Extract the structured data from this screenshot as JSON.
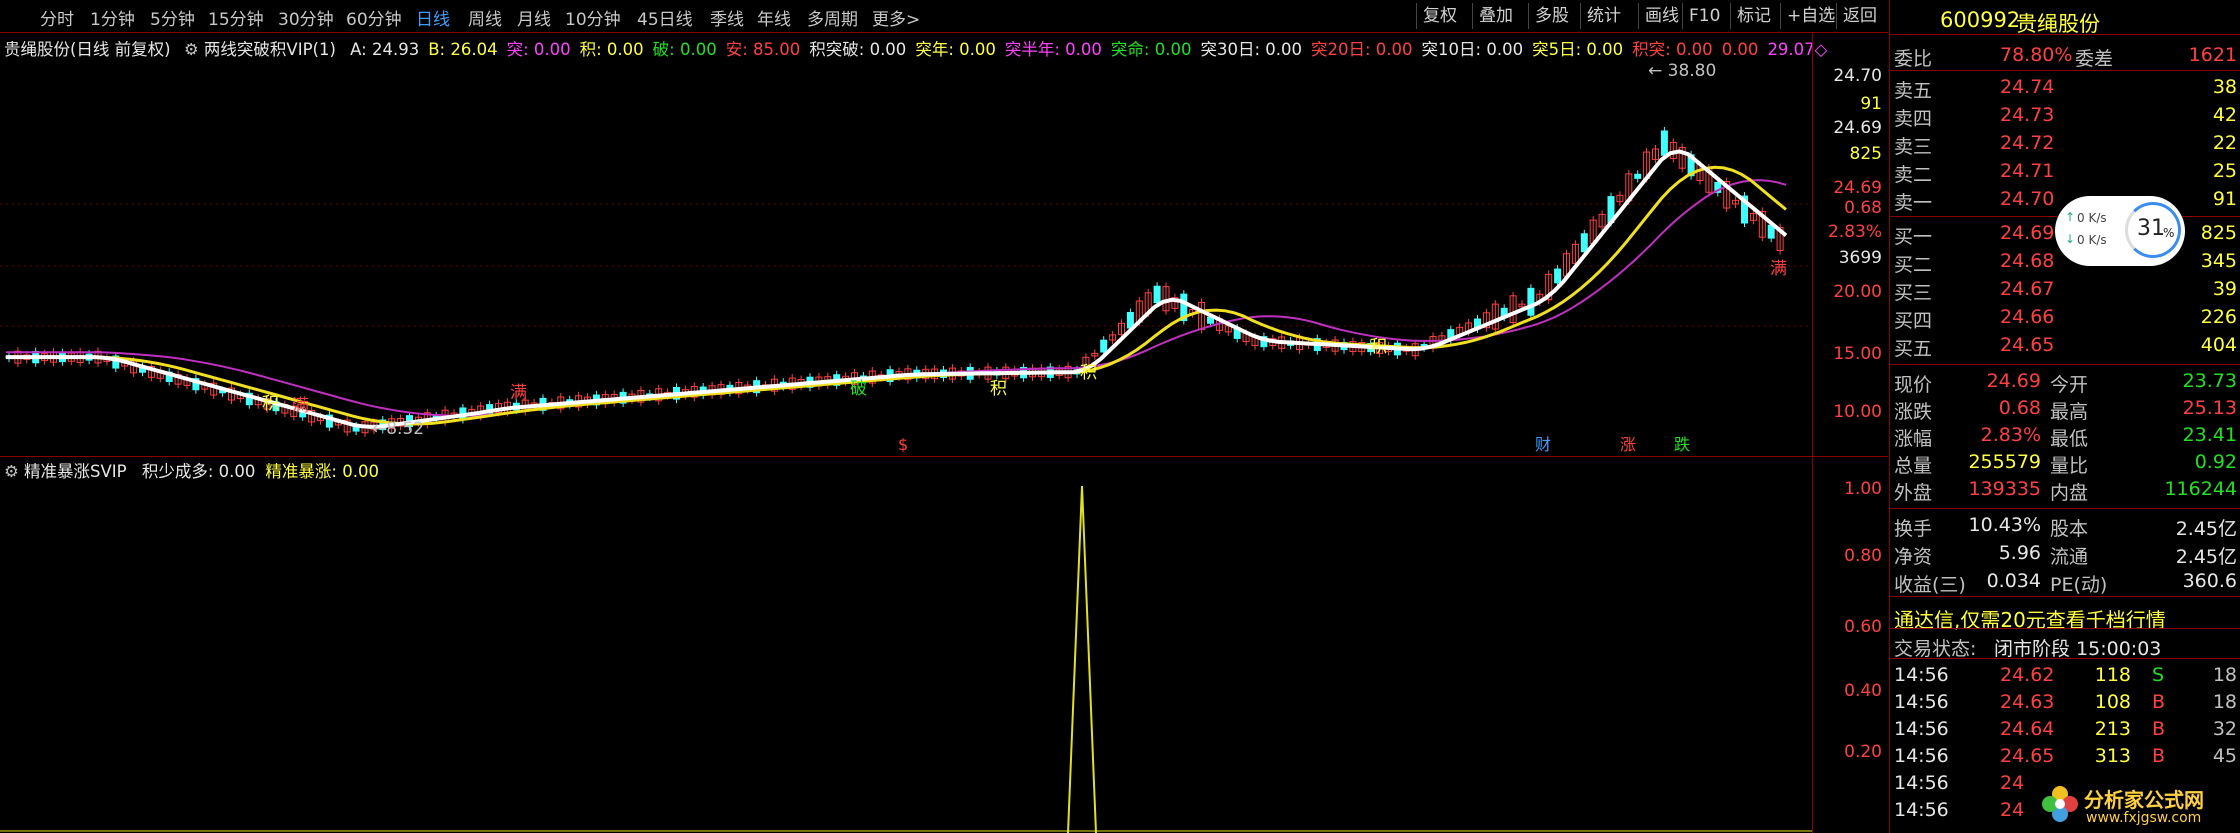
{
  "toolbar": {
    "periods": [
      "分时",
      "1分钟",
      "5分钟",
      "15分钟",
      "30分钟",
      "60分钟",
      "日线",
      "周线",
      "月线",
      "10分钟",
      "45日线",
      "季线",
      "年线",
      "多周期",
      "更多>"
    ],
    "active_period": "日线",
    "tools": [
      "复权",
      "叠加",
      "多股",
      "统计",
      "画线",
      "F10",
      "标记",
      "+自选",
      "返回"
    ]
  },
  "main_chart": {
    "title": "贵绳股份(日线 前复权)",
    "indicator_name": "两线突破积VIP(1)",
    "params": [
      {
        "label": "A: 24.93",
        "color": "#e6e6e6"
      },
      {
        "label": "B: 26.04",
        "color": "#ffff40"
      },
      {
        "label": "突: 0.00",
        "color": "#ff40ff"
      },
      {
        "label": "积: 0.00",
        "color": "#ffff40"
      },
      {
        "label": "破: 0.00",
        "color": "#20e020"
      },
      {
        "label": "安: 85.00",
        "color": "#ff4040"
      },
      {
        "label": "积突破: 0.00",
        "color": "#e6e6e6"
      },
      {
        "label": "突年: 0.00",
        "color": "#ffff40"
      },
      {
        "label": "突半年: 0.00",
        "color": "#ff40ff"
      },
      {
        "label": "突命: 0.00",
        "color": "#20e020"
      },
      {
        "label": "突30日: 0.00",
        "color": "#e6e6e6"
      },
      {
        "label": "突20日: 0.00",
        "color": "#ff4040"
      },
      {
        "label": "突10日: 0.00",
        "color": "#e6e6e6"
      },
      {
        "label": "突5日: 0.00",
        "color": "#ffff40"
      },
      {
        "label": "积突: 0.00",
        "color": "#ff4040"
      },
      {
        "label": "0.00",
        "color": "#ff4040"
      },
      {
        "label": "29.07◇",
        "color": "#ff40ff"
      }
    ],
    "y_axis": [
      "24.70",
      "91",
      "24.69",
      "825",
      "24.69",
      "0.68",
      "2.83%",
      "3699",
      "20.00",
      "15.00",
      "10.00"
    ],
    "y_axis_colors": [
      "#e6e6e6",
      "#ffff40",
      "#e6e6e6",
      "#ffff40",
      "#ff4040",
      "#ff4040",
      "#ff4040",
      "#e6e6e6",
      "#ff4040",
      "#ff4040",
      "#ff4040"
    ],
    "high_label": "38.80",
    "low_label": "8.52",
    "event_marks": [
      {
        "t": "$",
        "c": "#ff4040"
      },
      {
        "t": "财",
        "c": "#40a0ff"
      },
      {
        "t": "涨",
        "c": "#ff4040"
      },
      {
        "t": "跌",
        "c": "#20e020"
      }
    ],
    "signal_labels": [
      "积",
      "满",
      "满",
      "破",
      "积",
      "积",
      "积",
      "满"
    ]
  },
  "sub_chart": {
    "title": "精准暴涨SVIP",
    "params": [
      {
        "label": "积少成多: 0.00",
        "color": "#e6e6e6"
      },
      {
        "label": "精准暴涨: 0.00",
        "color": "#ffff40"
      }
    ],
    "y_axis": [
      "1.00",
      "0.80",
      "0.60",
      "0.40",
      "0.20"
    ]
  },
  "panel": {
    "code": "600992",
    "name": "贵绳股份",
    "weibi": {
      "label": "委比",
      "value": "78.80%",
      "label2": "委差",
      "value2": "1621"
    },
    "asks": [
      {
        "label": "卖五",
        "price": "24.74",
        "vol": "38"
      },
      {
        "label": "卖四",
        "price": "24.73",
        "vol": "42"
      },
      {
        "label": "卖三",
        "price": "24.72",
        "vol": "22"
      },
      {
        "label": "卖二",
        "price": "24.71",
        "vol": "25"
      },
      {
        "label": "卖一",
        "price": "24.70",
        "vol": "91"
      }
    ],
    "bids": [
      {
        "label": "买一",
        "price": "24.69",
        "vol": "825"
      },
      {
        "label": "买二",
        "price": "24.68",
        "vol": "345"
      },
      {
        "label": "买三",
        "price": "24.67",
        "vol": "39"
      },
      {
        "label": "买四",
        "price": "24.66",
        "vol": "226"
      },
      {
        "label": "买五",
        "price": "24.65",
        "vol": "404"
      }
    ],
    "stats": [
      {
        "l1": "现价",
        "v1": "24.69",
        "c1": "#ff4040",
        "l2": "今开",
        "v2": "23.73",
        "c2": "#20e020"
      },
      {
        "l1": "涨跌",
        "v1": "0.68",
        "c1": "#ff4040",
        "l2": "最高",
        "v2": "25.13",
        "c2": "#ff4040"
      },
      {
        "l1": "涨幅",
        "v1": "2.83%",
        "c1": "#ff4040",
        "l2": "最低",
        "v2": "23.41",
        "c2": "#20e020"
      },
      {
        "l1": "总量",
        "v1": "255579",
        "c1": "#ffff40",
        "l2": "量比",
        "v2": "0.92",
        "c2": "#20e020"
      },
      {
        "l1": "外盘",
        "v1": "139335",
        "c1": "#ff4040",
        "l2": "内盘",
        "v2": "116244",
        "c2": "#20e020"
      }
    ],
    "stats2": [
      {
        "l1": "换手",
        "v1": "10.43%",
        "l2": "股本",
        "v2": "2.45亿"
      },
      {
        "l1": "净资",
        "v1": "5.96",
        "l2": "流通",
        "v2": "2.45亿"
      },
      {
        "l1": "收益(三)",
        "v1": "0.034",
        "l2": "PE(动)",
        "v2": "360.6"
      }
    ],
    "promo": "通达信,仅需20元查看千档行情",
    "trade_status_label": "交易状态:",
    "trade_status": "闭市阶段 15:00:03",
    "ticks": [
      {
        "time": "14:56",
        "price": "24.62",
        "vol": "118",
        "side": "S",
        "n": "18"
      },
      {
        "time": "14:56",
        "price": "24.63",
        "vol": "108",
        "side": "B",
        "n": "18"
      },
      {
        "time": "14:56",
        "price": "24.64",
        "vol": "213",
        "side": "B",
        "n": "32"
      },
      {
        "time": "14:56",
        "price": "24.65",
        "vol": "313",
        "side": "B",
        "n": "45"
      },
      {
        "time": "14:56",
        "price": "24",
        "vol": "",
        "side": "",
        "n": ""
      },
      {
        "time": "14:56",
        "price": "24",
        "vol": "",
        "side": "",
        "n": ""
      }
    ],
    "net_widget": {
      "up": "0 K/s",
      "down": "0 K/s",
      "percent": "31",
      "unit": "%"
    },
    "watermark": {
      "text": "分析家公式网",
      "url": "www.fxjgsw.com"
    }
  }
}
